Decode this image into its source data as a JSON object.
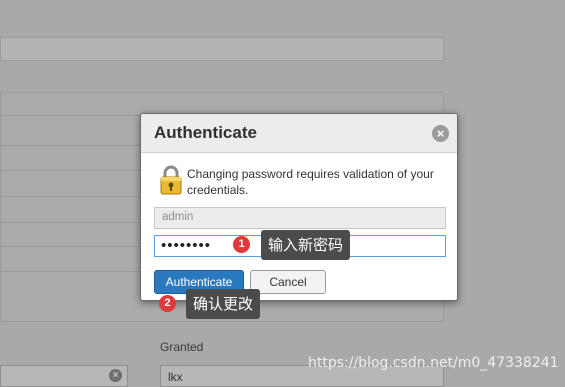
{
  "background": {
    "granted_label": "Granted",
    "granted_value": "lkx"
  },
  "dialog": {
    "title": "Authenticate",
    "message": "Changing password requires validation of your credentials.",
    "username_placeholder": "admin",
    "password_value": "••••••••",
    "authenticate_label": "Authenticate",
    "cancel_label": "Cancel"
  },
  "annotations": [
    {
      "number": "1",
      "text": "输入新密码"
    },
    {
      "number": "2",
      "text": "确认更改"
    }
  ],
  "watermark": "https://blog.csdn.net/m0_47338241",
  "colors": {
    "primary_button": "#2a78be",
    "badge": "#e0393c",
    "tooltip": "#4b4b4b"
  }
}
